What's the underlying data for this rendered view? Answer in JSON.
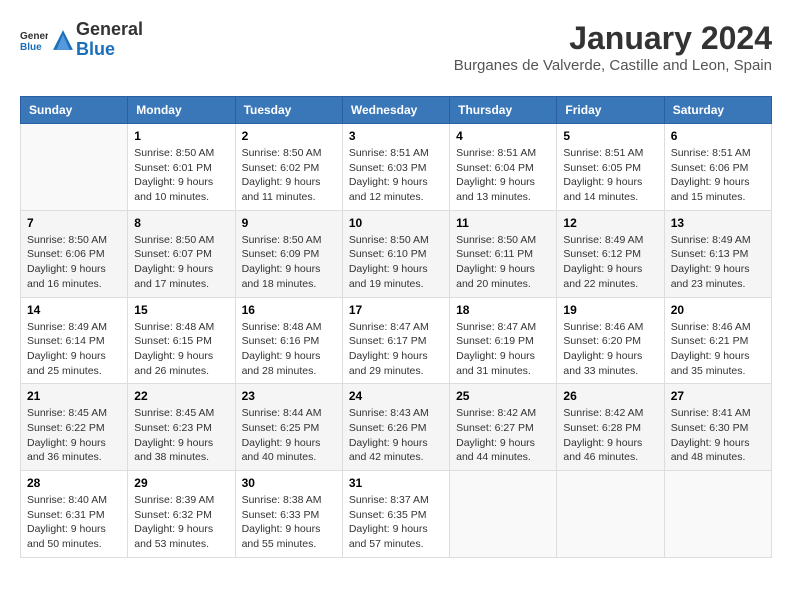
{
  "header": {
    "logo_line1": "General",
    "logo_line2": "Blue",
    "month_title": "January 2024",
    "location": "Burganes de Valverde, Castille and Leon, Spain"
  },
  "weekdays": [
    "Sunday",
    "Monday",
    "Tuesday",
    "Wednesday",
    "Thursday",
    "Friday",
    "Saturday"
  ],
  "weeks": [
    [
      {
        "day": "",
        "empty": true
      },
      {
        "day": "1",
        "sunrise": "Sunrise: 8:50 AM",
        "sunset": "Sunset: 6:01 PM",
        "daylight": "Daylight: 9 hours and 10 minutes."
      },
      {
        "day": "2",
        "sunrise": "Sunrise: 8:50 AM",
        "sunset": "Sunset: 6:02 PM",
        "daylight": "Daylight: 9 hours and 11 minutes."
      },
      {
        "day": "3",
        "sunrise": "Sunrise: 8:51 AM",
        "sunset": "Sunset: 6:03 PM",
        "daylight": "Daylight: 9 hours and 12 minutes."
      },
      {
        "day": "4",
        "sunrise": "Sunrise: 8:51 AM",
        "sunset": "Sunset: 6:04 PM",
        "daylight": "Daylight: 9 hours and 13 minutes."
      },
      {
        "day": "5",
        "sunrise": "Sunrise: 8:51 AM",
        "sunset": "Sunset: 6:05 PM",
        "daylight": "Daylight: 9 hours and 14 minutes."
      },
      {
        "day": "6",
        "sunrise": "Sunrise: 8:51 AM",
        "sunset": "Sunset: 6:06 PM",
        "daylight": "Daylight: 9 hours and 15 minutes."
      }
    ],
    [
      {
        "day": "7",
        "sunrise": "Sunrise: 8:50 AM",
        "sunset": "Sunset: 6:06 PM",
        "daylight": "Daylight: 9 hours and 16 minutes."
      },
      {
        "day": "8",
        "sunrise": "Sunrise: 8:50 AM",
        "sunset": "Sunset: 6:07 PM",
        "daylight": "Daylight: 9 hours and 17 minutes."
      },
      {
        "day": "9",
        "sunrise": "Sunrise: 8:50 AM",
        "sunset": "Sunset: 6:09 PM",
        "daylight": "Daylight: 9 hours and 18 minutes."
      },
      {
        "day": "10",
        "sunrise": "Sunrise: 8:50 AM",
        "sunset": "Sunset: 6:10 PM",
        "daylight": "Daylight: 9 hours and 19 minutes."
      },
      {
        "day": "11",
        "sunrise": "Sunrise: 8:50 AM",
        "sunset": "Sunset: 6:11 PM",
        "daylight": "Daylight: 9 hours and 20 minutes."
      },
      {
        "day": "12",
        "sunrise": "Sunrise: 8:49 AM",
        "sunset": "Sunset: 6:12 PM",
        "daylight": "Daylight: 9 hours and 22 minutes."
      },
      {
        "day": "13",
        "sunrise": "Sunrise: 8:49 AM",
        "sunset": "Sunset: 6:13 PM",
        "daylight": "Daylight: 9 hours and 23 minutes."
      }
    ],
    [
      {
        "day": "14",
        "sunrise": "Sunrise: 8:49 AM",
        "sunset": "Sunset: 6:14 PM",
        "daylight": "Daylight: 9 hours and 25 minutes."
      },
      {
        "day": "15",
        "sunrise": "Sunrise: 8:48 AM",
        "sunset": "Sunset: 6:15 PM",
        "daylight": "Daylight: 9 hours and 26 minutes."
      },
      {
        "day": "16",
        "sunrise": "Sunrise: 8:48 AM",
        "sunset": "Sunset: 6:16 PM",
        "daylight": "Daylight: 9 hours and 28 minutes."
      },
      {
        "day": "17",
        "sunrise": "Sunrise: 8:47 AM",
        "sunset": "Sunset: 6:17 PM",
        "daylight": "Daylight: 9 hours and 29 minutes."
      },
      {
        "day": "18",
        "sunrise": "Sunrise: 8:47 AM",
        "sunset": "Sunset: 6:19 PM",
        "daylight": "Daylight: 9 hours and 31 minutes."
      },
      {
        "day": "19",
        "sunrise": "Sunrise: 8:46 AM",
        "sunset": "Sunset: 6:20 PM",
        "daylight": "Daylight: 9 hours and 33 minutes."
      },
      {
        "day": "20",
        "sunrise": "Sunrise: 8:46 AM",
        "sunset": "Sunset: 6:21 PM",
        "daylight": "Daylight: 9 hours and 35 minutes."
      }
    ],
    [
      {
        "day": "21",
        "sunrise": "Sunrise: 8:45 AM",
        "sunset": "Sunset: 6:22 PM",
        "daylight": "Daylight: 9 hours and 36 minutes."
      },
      {
        "day": "22",
        "sunrise": "Sunrise: 8:45 AM",
        "sunset": "Sunset: 6:23 PM",
        "daylight": "Daylight: 9 hours and 38 minutes."
      },
      {
        "day": "23",
        "sunrise": "Sunrise: 8:44 AM",
        "sunset": "Sunset: 6:25 PM",
        "daylight": "Daylight: 9 hours and 40 minutes."
      },
      {
        "day": "24",
        "sunrise": "Sunrise: 8:43 AM",
        "sunset": "Sunset: 6:26 PM",
        "daylight": "Daylight: 9 hours and 42 minutes."
      },
      {
        "day": "25",
        "sunrise": "Sunrise: 8:42 AM",
        "sunset": "Sunset: 6:27 PM",
        "daylight": "Daylight: 9 hours and 44 minutes."
      },
      {
        "day": "26",
        "sunrise": "Sunrise: 8:42 AM",
        "sunset": "Sunset: 6:28 PM",
        "daylight": "Daylight: 9 hours and 46 minutes."
      },
      {
        "day": "27",
        "sunrise": "Sunrise: 8:41 AM",
        "sunset": "Sunset: 6:30 PM",
        "daylight": "Daylight: 9 hours and 48 minutes."
      }
    ],
    [
      {
        "day": "28",
        "sunrise": "Sunrise: 8:40 AM",
        "sunset": "Sunset: 6:31 PM",
        "daylight": "Daylight: 9 hours and 50 minutes."
      },
      {
        "day": "29",
        "sunrise": "Sunrise: 8:39 AM",
        "sunset": "Sunset: 6:32 PM",
        "daylight": "Daylight: 9 hours and 53 minutes."
      },
      {
        "day": "30",
        "sunrise": "Sunrise: 8:38 AM",
        "sunset": "Sunset: 6:33 PM",
        "daylight": "Daylight: 9 hours and 55 minutes."
      },
      {
        "day": "31",
        "sunrise": "Sunrise: 8:37 AM",
        "sunset": "Sunset: 6:35 PM",
        "daylight": "Daylight: 9 hours and 57 minutes."
      },
      {
        "day": "",
        "empty": true
      },
      {
        "day": "",
        "empty": true
      },
      {
        "day": "",
        "empty": true
      }
    ]
  ]
}
